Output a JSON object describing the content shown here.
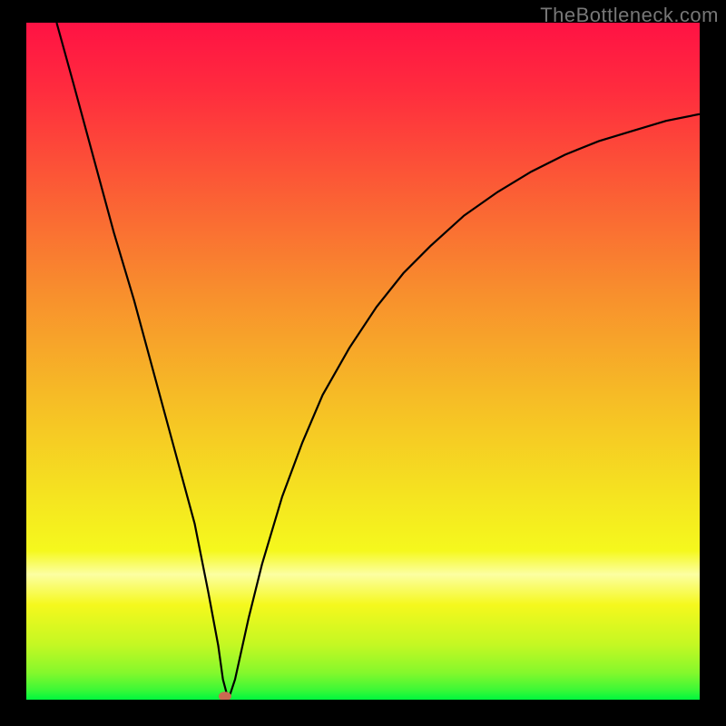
{
  "watermark": "TheBottleneck.com",
  "chart_data": {
    "type": "line",
    "title": "",
    "xlabel": "",
    "ylabel": "",
    "xlim": [
      0,
      100
    ],
    "ylim": [
      0,
      100
    ],
    "background_gradient": {
      "stops": [
        {
          "offset": 0.0,
          "color": "#ff1244"
        },
        {
          "offset": 0.1,
          "color": "#ff2c3e"
        },
        {
          "offset": 0.25,
          "color": "#fb5e35"
        },
        {
          "offset": 0.4,
          "color": "#f88f2d"
        },
        {
          "offset": 0.55,
          "color": "#f6bb26"
        },
        {
          "offset": 0.7,
          "color": "#f5e420"
        },
        {
          "offset": 0.78,
          "color": "#f5f81d"
        },
        {
          "offset": 0.815,
          "color": "#fcffa2"
        },
        {
          "offset": 0.86,
          "color": "#f5f81d"
        },
        {
          "offset": 0.92,
          "color": "#c3f823"
        },
        {
          "offset": 0.96,
          "color": "#85f82c"
        },
        {
          "offset": 0.985,
          "color": "#3ef836"
        },
        {
          "offset": 1.0,
          "color": "#00f73e"
        }
      ]
    },
    "series": [
      {
        "name": "bottleneck-curve",
        "x": [
          4.5,
          7,
          10,
          13,
          16,
          19,
          22,
          25,
          27,
          28.5,
          29.2,
          30,
          31,
          33,
          35,
          38,
          41,
          44,
          48,
          52,
          56,
          60,
          65,
          70,
          75,
          80,
          85,
          90,
          95,
          100
        ],
        "y": [
          100,
          91,
          80,
          69,
          59,
          48,
          37,
          26,
          16,
          8,
          3,
          0,
          3,
          12,
          20,
          30,
          38,
          45,
          52,
          58,
          63,
          67,
          71.5,
          75,
          78,
          80.5,
          82.5,
          84,
          85.5,
          86.5
        ]
      }
    ],
    "marker": {
      "x": 29.5,
      "y": 0.5,
      "color": "#c96a51"
    }
  }
}
